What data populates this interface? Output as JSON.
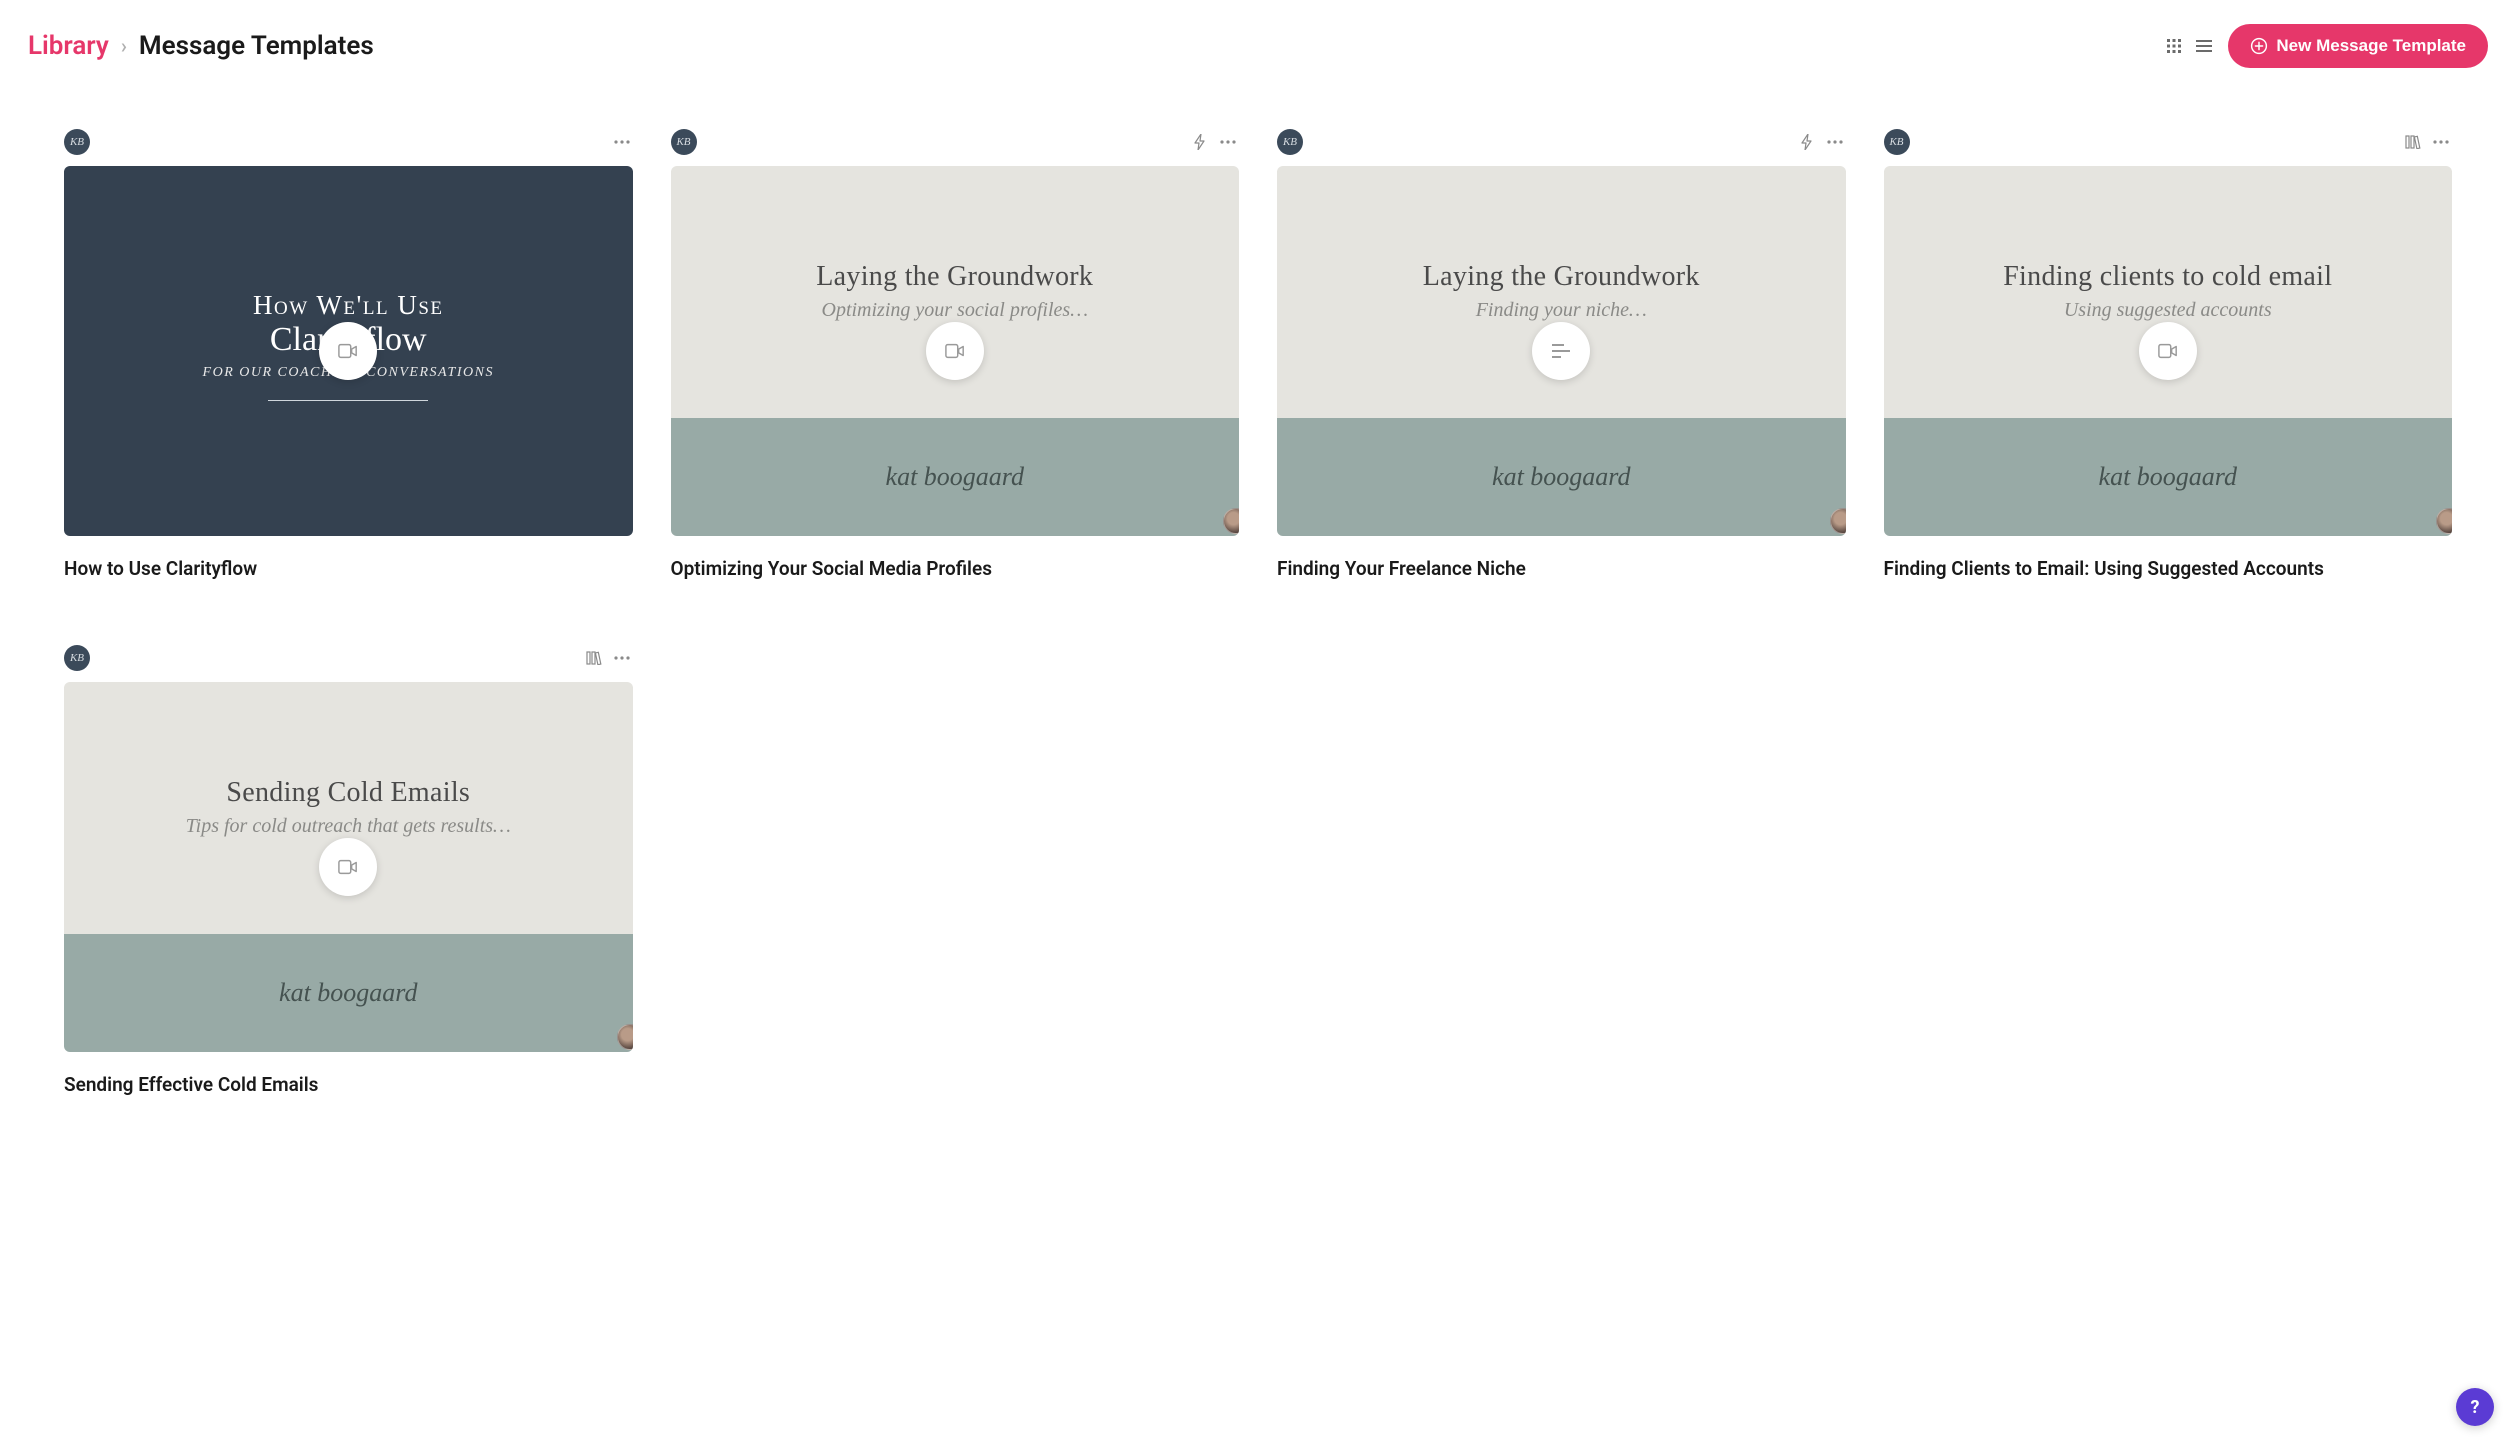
{
  "breadcrumb": {
    "library": "Library",
    "current": "Message Templates"
  },
  "buttons": {
    "new_template": "New Message Template"
  },
  "cards": [
    {
      "title": "How to Use Clarityflow",
      "thumb": {
        "style": "dark",
        "heading": "How We'll Use",
        "script": "Clarityflow",
        "sub": "FOR OUR COACHING CONVERSATIONS",
        "center_icon": "video"
      },
      "actions": [
        "more"
      ]
    },
    {
      "title": "Optimizing Your Social Media Profiles",
      "thumb": {
        "style": "light",
        "heading": "Laying the Groundwork",
        "sub": "Optimizing your social profiles…",
        "signature": "kat boogaard",
        "center_icon": "video"
      },
      "actions": [
        "bolt",
        "more"
      ]
    },
    {
      "title": "Finding Your Freelance Niche",
      "thumb": {
        "style": "light",
        "heading": "Laying the Groundwork",
        "sub": "Finding your niche…",
        "signature": "kat boogaard",
        "center_icon": "text"
      },
      "actions": [
        "bolt",
        "more"
      ]
    },
    {
      "title": "Finding Clients to Email: Using Suggested Accounts",
      "thumb": {
        "style": "light",
        "heading": "Finding clients to cold email",
        "sub": "Using suggested accounts",
        "signature": "kat boogaard",
        "center_icon": "video"
      },
      "actions": [
        "library",
        "more"
      ]
    },
    {
      "title": "Sending Effective Cold Emails",
      "thumb": {
        "style": "light",
        "heading": "Sending Cold Emails",
        "sub": "Tips for cold outreach that gets results…",
        "signature": "kat boogaard",
        "center_icon": "video"
      },
      "actions": [
        "library",
        "more"
      ]
    }
  ]
}
